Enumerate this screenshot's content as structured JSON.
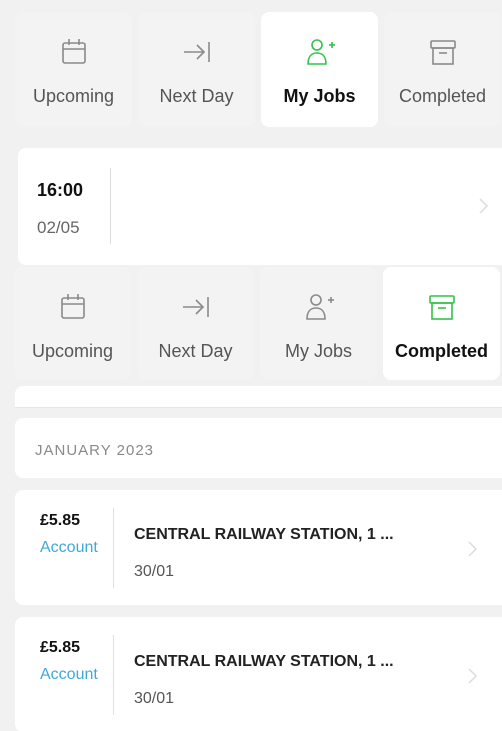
{
  "top_tabs": [
    {
      "label": "Upcoming",
      "icon": "calendar-icon",
      "active": false
    },
    {
      "label": "Next Day",
      "icon": "arrow-to-line-icon",
      "active": false
    },
    {
      "label": "My Jobs",
      "icon": "user-add-icon",
      "active": true
    },
    {
      "label": "Completed",
      "icon": "archive-box-icon",
      "active": false
    }
  ],
  "upcoming_job": {
    "time": "16:00",
    "date": "02/05"
  },
  "bottom_tabs": [
    {
      "label": "Upcoming",
      "icon": "calendar-icon",
      "active": false
    },
    {
      "label": "Next Day",
      "icon": "arrow-to-line-icon",
      "active": false
    },
    {
      "label": "My Jobs",
      "icon": "user-add-icon",
      "active": false
    },
    {
      "label": "Completed",
      "icon": "archive-box-icon",
      "active": true
    }
  ],
  "completed": {
    "month_header": "JANUARY 2023",
    "rows": [
      {
        "price": "£5.85",
        "payment": "Account",
        "address": "CENTRAL RAILWAY STATION, 1 ...",
        "date": "30/01"
      },
      {
        "price": "£5.85",
        "payment": "Account",
        "address": "CENTRAL RAILWAY STATION, 1 ...",
        "date": "30/01"
      }
    ]
  },
  "colors": {
    "accent_green": "#34c24a",
    "icon_grey": "#8a8a8a",
    "link_blue": "#3fa9d9",
    "background": "#f1f1f1",
    "card": "#ffffff"
  }
}
